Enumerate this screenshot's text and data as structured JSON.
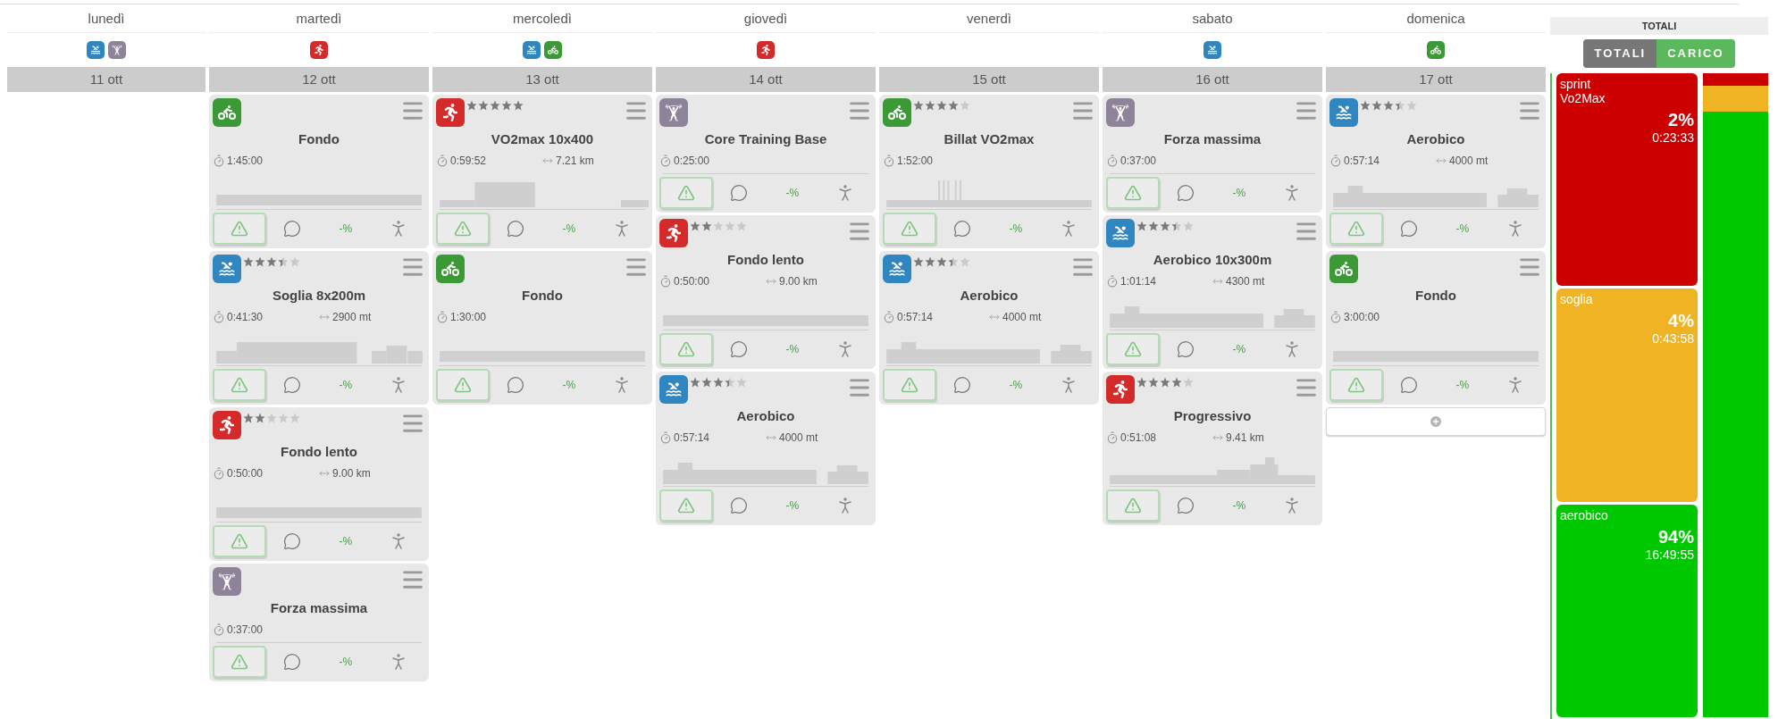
{
  "days": [
    {
      "name": "lunedì",
      "sports": [
        {
          "kind": "swim"
        },
        {
          "kind": "strength"
        }
      ],
      "date": "11 ott",
      "add_button": false
    },
    {
      "name": "martedì",
      "sports": [
        {
          "kind": "run"
        }
      ],
      "date": "12 ott",
      "add_button": false,
      "workouts": [
        {
          "kind": "bike",
          "title": "Fondo",
          "duration": "1:45:00",
          "profile": {
            "kind": "flat"
          },
          "load": "-%"
        },
        {
          "kind": "swim",
          "stars": 3.5,
          "title": "Soglia 8x200m",
          "duration": "0:41:30",
          "distance": "2900 mt",
          "profile": {
            "kind": "intervals"
          },
          "load": "-%"
        },
        {
          "kind": "run",
          "stars": 2,
          "title": "Fondo lento",
          "duration": "0:50:00",
          "distance": "9.00 km",
          "profile": {
            "kind": "flat"
          },
          "load": "-%"
        },
        {
          "kind": "strength",
          "title": "Forza massima",
          "duration": "0:37:00",
          "load": "-%"
        }
      ]
    },
    {
      "name": "mercoledì",
      "sports": [
        {
          "kind": "swim"
        },
        {
          "kind": "bike"
        }
      ],
      "date": "13 ott",
      "add_button": false,
      "workouts": [
        {
          "kind": "run",
          "stars": 5,
          "title": "VO2max 10x400",
          "duration": "0:59:52",
          "distance": "7.21 km",
          "profile": {
            "kind": "block"
          },
          "load": "-%"
        },
        {
          "kind": "bike",
          "title": "Fondo",
          "duration": "1:30:00",
          "profile": {
            "kind": "flat"
          },
          "load": "-%"
        }
      ]
    },
    {
      "name": "giovedì",
      "sports": [
        {
          "kind": "run"
        }
      ],
      "date": "14 ott",
      "add_button": false,
      "workouts": [
        {
          "kind": "strength",
          "title": "Core Training Base",
          "duration": "0:25:00",
          "load": "-%"
        },
        {
          "kind": "run",
          "stars": 2,
          "title": "Fondo lento",
          "duration": "0:50:00",
          "distance": "9.00 km",
          "profile": {
            "kind": "flat"
          },
          "load": "-%"
        },
        {
          "kind": "swim",
          "stars": 3.5,
          "title": "Aerobico",
          "duration": "0:57:14",
          "distance": "4000 mt",
          "profile": {
            "kind": "warmup"
          },
          "load": "-%"
        }
      ]
    },
    {
      "name": "venerdì",
      "date": "15 ott",
      "add_button": false,
      "workouts": [
        {
          "kind": "bike",
          "stars": 4,
          "title": "Billat VO2max",
          "duration": "1:52:00",
          "profile": {
            "kind": "spikes"
          },
          "load": "-%"
        },
        {
          "kind": "swim",
          "stars": 3.5,
          "title": "Aerobico",
          "duration": "0:57:14",
          "distance": "4000 mt",
          "profile": {
            "kind": "warmup"
          },
          "load": "-%"
        }
      ]
    },
    {
      "name": "sabato",
      "sports": [
        {
          "kind": "swim"
        }
      ],
      "date": "16 ott",
      "add_button": false,
      "workouts": [
        {
          "kind": "strength",
          "title": "Forza massima",
          "duration": "0:37:00",
          "load": "-%"
        },
        {
          "kind": "swim",
          "stars": 3.5,
          "title": "Aerobico 10x300m",
          "duration": "1:01:14",
          "distance": "4300 mt",
          "profile": {
            "kind": "warmup"
          },
          "load": "-%"
        },
        {
          "kind": "run",
          "stars": 4,
          "title": "Progressivo",
          "duration": "0:51:08",
          "distance": "9.41 km",
          "profile": {
            "kind": "ramp"
          },
          "load": "-%"
        }
      ]
    },
    {
      "name": "domenica",
      "sports": [
        {
          "kind": "bike"
        }
      ],
      "date": "17 ott",
      "add_button": true,
      "workouts": [
        {
          "kind": "swim",
          "stars": 3.5,
          "title": "Aerobico",
          "duration": "0:57:14",
          "distance": "4000 mt",
          "profile": {
            "kind": "warmup"
          },
          "load": "-%"
        },
        {
          "kind": "bike",
          "title": "Fondo",
          "duration": "3:00:00",
          "profile": {
            "kind": "flat"
          },
          "load": "-%"
        }
      ]
    }
  ],
  "totals": {
    "header": "TOTALI",
    "toggles": [
      {
        "label": "TOTALI",
        "selected": false
      },
      {
        "label": "CARICO",
        "selected": true
      }
    ],
    "zones": [
      {
        "name": "sprint Vo2Max",
        "percent": "2%",
        "time": "0:23:33",
        "color": "#cc0000"
      },
      {
        "name": "soglia",
        "percent": "4%",
        "time": "0:43:58",
        "color": "#f0b323"
      },
      {
        "name": "aerobico",
        "percent": "94%",
        "time": "16:49:55",
        "color": "#00c800"
      }
    ]
  }
}
